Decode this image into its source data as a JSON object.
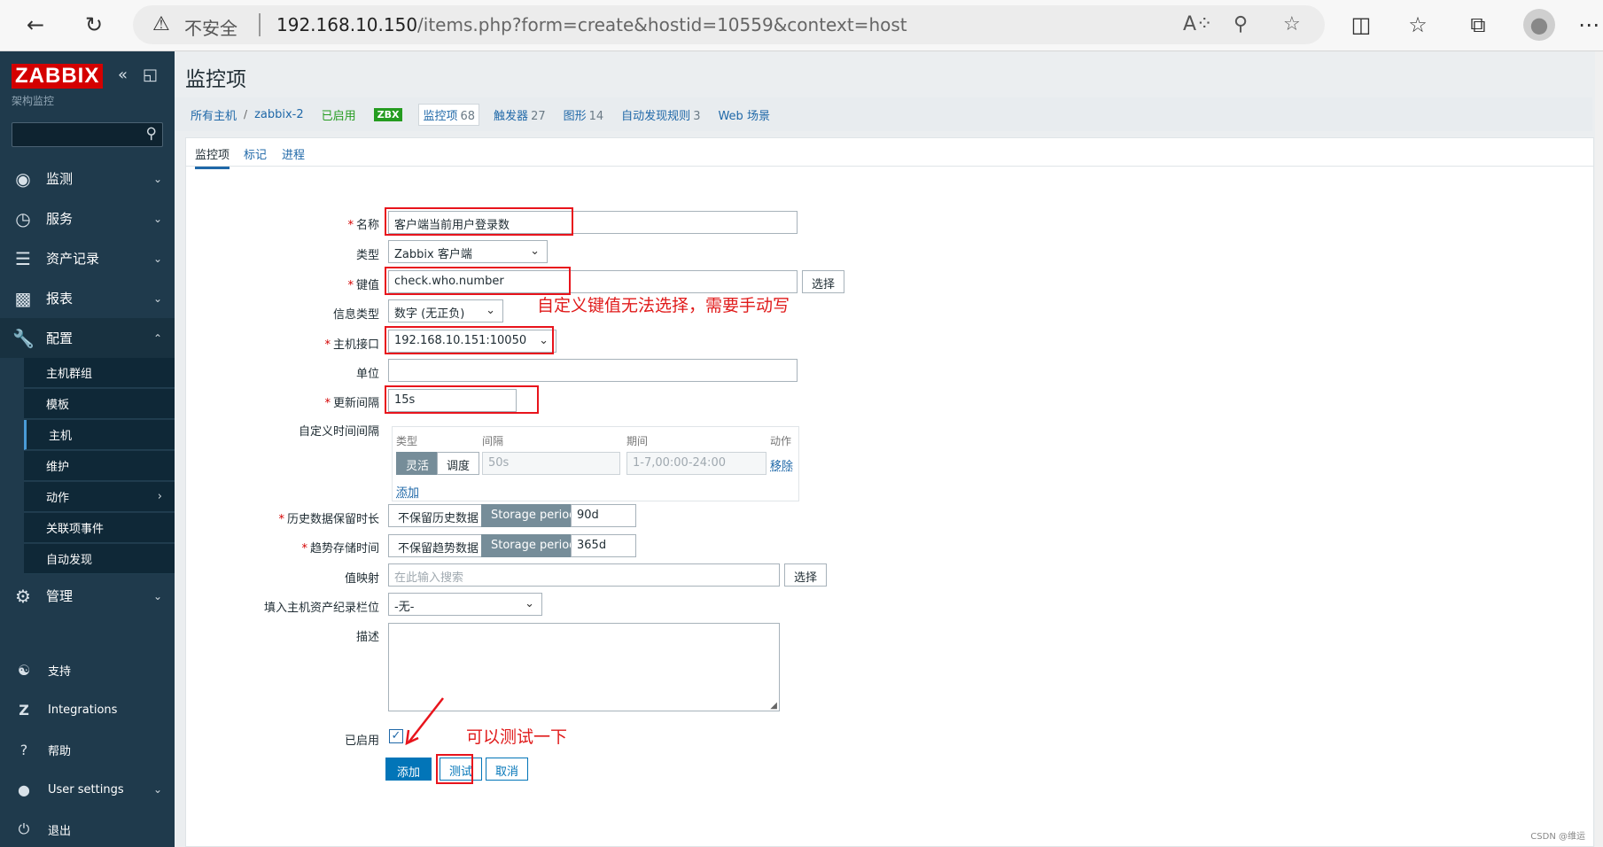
{
  "browser": {
    "insecure_label": "不安全",
    "url_host": "192.168.10.150",
    "url_path": "/items.php?form=create&hostid=10559&context=host"
  },
  "sidebar": {
    "logo": "ZABBIX",
    "subtitle": "架构监控",
    "menu": [
      {
        "label": "监测",
        "icon": "eye-icon"
      },
      {
        "label": "服务",
        "icon": "clock-icon"
      },
      {
        "label": "资产记录",
        "icon": "list-icon"
      },
      {
        "label": "报表",
        "icon": "bar-chart-icon"
      },
      {
        "label": "配置",
        "icon": "wrench-icon"
      }
    ],
    "submenu": [
      "主机群组",
      "模板",
      "主机",
      "维护",
      "动作",
      "关联项事件",
      "自动发现"
    ],
    "admin": "管理",
    "footer": [
      "支持",
      "Integrations",
      "帮助",
      "User settings",
      "退出"
    ]
  },
  "page": {
    "title": "监控项",
    "breadcrumbs": {
      "all_hosts": "所有主机",
      "host": "zabbix-2",
      "enabled": "已启用",
      "zbx": "ZBX",
      "items": "监控项",
      "items_count": "68",
      "triggers": "触发器",
      "triggers_count": "27",
      "graphs": "图形",
      "graphs_count": "14",
      "discovery": "自动发现规则",
      "discovery_count": "3",
      "web": "Web 场景"
    },
    "tabs": [
      "监控项",
      "标记",
      "进程"
    ]
  },
  "form": {
    "name_label": "名称",
    "name_value": "客户端当前用户登录数",
    "type_label": "类型",
    "type_value": "Zabbix 客户端",
    "key_label": "键值",
    "key_value": "check.who.number",
    "select_button": "选择",
    "info_type_label": "信息类型",
    "info_type_value": "数字 (无正负)",
    "interface_label": "主机接口",
    "interface_value": "192.168.10.151:10050",
    "units_label": "单位",
    "units_value": "",
    "interval_label": "更新间隔",
    "interval_value": "15s",
    "custom_label": "自定义时间间隔",
    "custom_headers": [
      "类型",
      "间隔",
      "期间",
      "动作"
    ],
    "flexible": "灵活",
    "scheduling": "调度",
    "custom_interval_ph": "50s",
    "custom_period_ph": "1-7,00:00-24:00",
    "remove": "移除",
    "add": "添加",
    "history_label": "历史数据保留时长",
    "history_no": "不保留历史数据",
    "storage_period": "Storage period",
    "history_value": "90d",
    "trends_label": "趋势存储时间",
    "trends_no": "不保留趋势数据",
    "trends_value": "365d",
    "valuemap_label": "值映射",
    "valuemap_ph": "在此输入搜索",
    "inventory_label": "填入主机资产纪录栏位",
    "inventory_value": "-无-",
    "desc_label": "描述",
    "enabled_label": "已启用",
    "btn_add": "添加",
    "btn_test": "测试",
    "btn_cancel": "取消"
  },
  "annotations": {
    "key_note": "自定义键值无法选择，需要手动写",
    "test_note": "可以测试一下"
  },
  "watermark": "CSDN @维运"
}
